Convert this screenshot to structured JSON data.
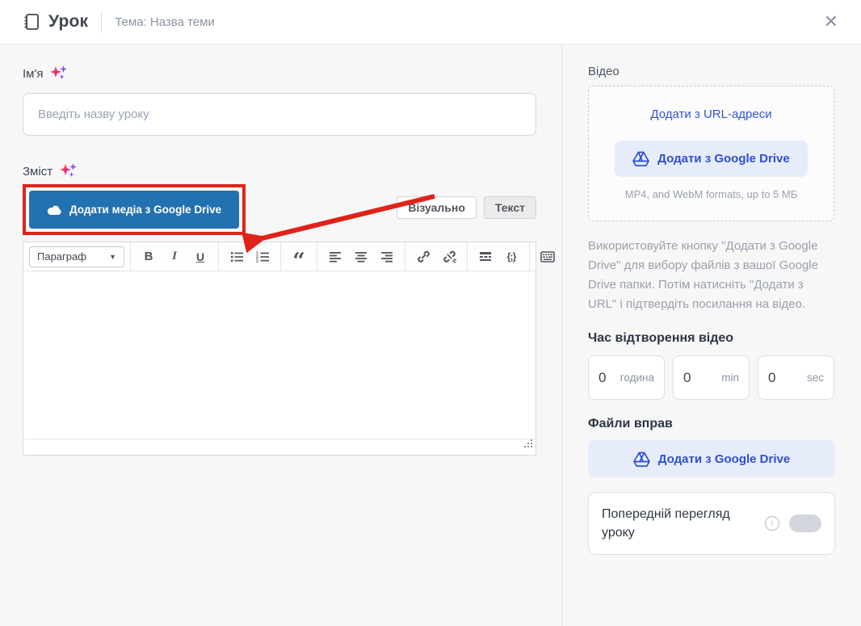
{
  "header": {
    "title": "Урок",
    "subtitle": "Тема: Назва теми",
    "close_glyph": "✕"
  },
  "form": {
    "name_label": "Ім'я",
    "name_placeholder": "Введіть назву уроку",
    "content_label": "Зміст",
    "add_media_button": "Додати медіа з Google Drive",
    "tabs": [
      {
        "label": "Візуально"
      },
      {
        "label": "Текст"
      }
    ],
    "editor": {
      "paragraph_dropdown": "Параграф",
      "content": "",
      "toolbar_icons": [
        "paragraph-dropdown",
        "bold",
        "italic",
        "underline",
        "bulleted-list",
        "numbered-list",
        "blockquote",
        "align-left",
        "align-center",
        "align-right",
        "link",
        "unlink",
        "more-tag",
        "code",
        "keyboard"
      ]
    }
  },
  "annotations": {
    "highlight_color": "#e0231a",
    "arrow_color": "#e0231a",
    "highlight_target": "add-media-from-google-drive-button"
  },
  "sidebar": {
    "video": {
      "label": "Відео",
      "add_url_link": "Додати з URL-адреси",
      "add_drive_button": "Додати з Google Drive",
      "formats_note": "MP4, and WebM formats, up to 5 МБ",
      "help_text": "Використовуйте кнопку \"Додати з Google Drive\" для вибору файлів з вашої Google Drive папки. Потім натисніть \"Додати з URL\" і підтвердіть посилання на відео."
    },
    "duration": {
      "label": "Час відтворення відео",
      "fields": [
        {
          "value": "0",
          "unit": "година"
        },
        {
          "value": "0",
          "unit": "min"
        },
        {
          "value": "0",
          "unit": "sec"
        }
      ]
    },
    "exercise_files": {
      "label": "Файли вправ",
      "add_drive_button": "Додати з Google Drive"
    },
    "preview": {
      "label": "Попередній перегляд уроку",
      "info_glyph": "i",
      "toggle_on": false
    }
  },
  "colors": {
    "wp_button_blue": "#2271b1",
    "link_blue": "#2f55d4",
    "lavender_button": "#e7ecfb",
    "highlight_red": "#e0231a"
  }
}
